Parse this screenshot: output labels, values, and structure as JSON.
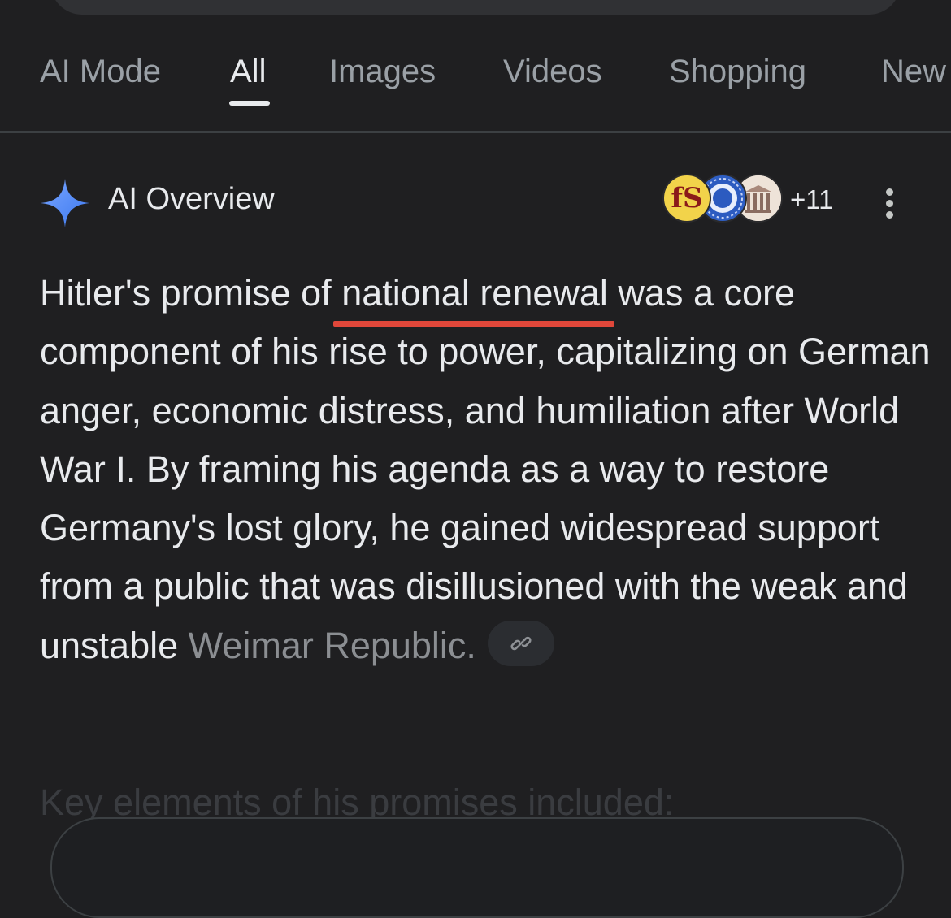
{
  "tabs": [
    {
      "label": "AI Mode",
      "active": false
    },
    {
      "label": "All",
      "active": true
    },
    {
      "label": "Images",
      "active": false
    },
    {
      "label": "Videos",
      "active": false
    },
    {
      "label": "Shopping",
      "active": false
    },
    {
      "label": "New",
      "active": false
    }
  ],
  "ai_overview": {
    "title": "AI Overview",
    "sparkle_icon": "sparkle-icon",
    "source_avatars": [
      "fS",
      "source-logo-2",
      "source-logo-3"
    ],
    "more_sources": "+11",
    "menu_icon": "more-vert-icon",
    "paragraph": {
      "before": "Hitler's promise of ",
      "highlight": "national renewal",
      "after": " was a core component of his rise to power, capitalizing on German anger, economic distress, and humiliation after World War I. By framing his agenda as a way to restore Germany's lost glory, he gained widespread support from a public that was disillusioned with the weak and unstable ",
      "faded": "Weimar Republic.",
      "link_icon": "link-icon"
    },
    "next_heading": "Key elements of his promises included:"
  },
  "colors": {
    "background": "#1f1f21",
    "text": "#e8eaed",
    "muted": "#9aa0a6",
    "highlight_underline": "#e0473a",
    "sparkle": "#4f8cf7"
  }
}
